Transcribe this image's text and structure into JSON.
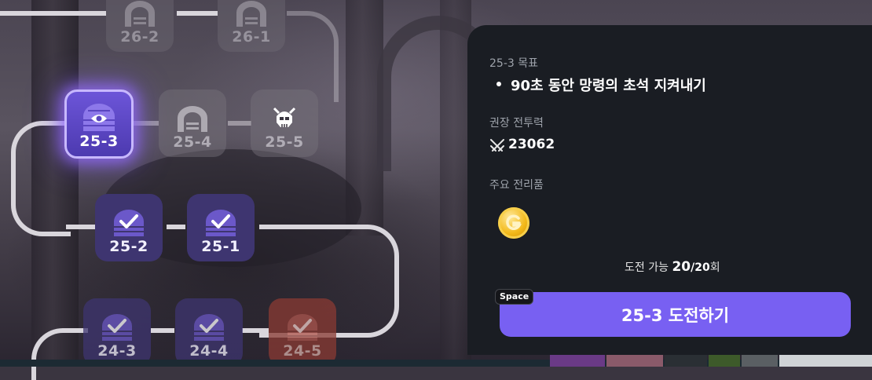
{
  "stages": [
    {
      "id": "26-2",
      "state": "locked",
      "icon": "gate-icon"
    },
    {
      "id": "26-1",
      "state": "locked",
      "icon": "gate-icon"
    },
    {
      "id": "25-3",
      "state": "current",
      "icon": "gate-eye-icon"
    },
    {
      "id": "25-4",
      "state": "locked",
      "icon": "gate-icon"
    },
    {
      "id": "25-5",
      "state": "locked-boss",
      "icon": "skull-icon"
    },
    {
      "id": "25-2",
      "state": "cleared",
      "icon": "gate-check-icon"
    },
    {
      "id": "25-1",
      "state": "cleared",
      "icon": "gate-check-icon"
    },
    {
      "id": "24-3",
      "state": "cleared",
      "icon": "gate-check-icon"
    },
    {
      "id": "24-4",
      "state": "cleared",
      "icon": "gate-check-icon"
    },
    {
      "id": "24-5",
      "state": "cleared-boss",
      "icon": "gate-check-icon"
    }
  ],
  "panel": {
    "objective_title": "25-3 목표",
    "objective_text": "90초 동안 망령의 초석 지켜내기",
    "power_label": "권장 전투력",
    "power_value": "23062",
    "loot_label": "주요 전리품",
    "loot_icon": "gold-coin-icon",
    "tries_label": "도전 가능",
    "tries_current": "20",
    "tries_max": "/20",
    "tries_unit": "회",
    "start_button": "25-3 도전하기",
    "hotkey": "Space"
  },
  "colors": {
    "accent": "#7860f2",
    "panel_bg": "#1a1d23",
    "cleared_node": "#3e3570",
    "boss_node": "#8a3a33"
  }
}
